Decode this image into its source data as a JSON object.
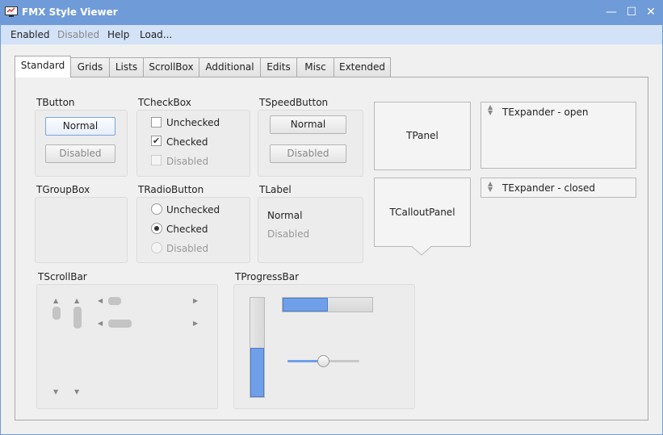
{
  "window": {
    "title": "FMX Style Viewer",
    "minimize_glyph": "—",
    "maximize_glyph": "☐",
    "close_glyph": "✕",
    "accent_color": "#6f9bd8"
  },
  "menu": {
    "items": [
      {
        "label": "Enabled"
      },
      {
        "label": "Disabled"
      },
      {
        "label": "Help"
      },
      {
        "label": "Load..."
      }
    ]
  },
  "tabs": [
    {
      "label": "Standard"
    },
    {
      "label": "Grids"
    },
    {
      "label": "Lists"
    },
    {
      "label": "ScrollBox"
    },
    {
      "label": "Additional"
    },
    {
      "label": "Edits"
    },
    {
      "label": "Misc"
    },
    {
      "label": "Extended"
    }
  ],
  "standard": {
    "tbutton": {
      "label": "TButton",
      "normal": "Normal",
      "disabled": "Disabled"
    },
    "tcheckbox": {
      "label": "TCheckBox",
      "unchecked": "Unchecked",
      "checked": "Checked",
      "disabled": "Disabled"
    },
    "tspeedbutton": {
      "label": "TSpeedButton",
      "normal": "Normal",
      "disabled": "Disabled"
    },
    "tgroupbox": {
      "label": "TGroupBox"
    },
    "tradiobutton": {
      "label": "TRadioButton",
      "unchecked": "Unchecked",
      "checked": "Checked",
      "disabled": "Disabled"
    },
    "tlabel": {
      "label": "TLabel",
      "normal": "Normal",
      "disabled": "Disabled"
    },
    "tpanel": {
      "label": "TPanel"
    },
    "tcalloutpanel": {
      "label": "TCalloutPanel"
    },
    "texpander_open": {
      "label": "TExpander - open"
    },
    "texpander_closed": {
      "label": "TExpander - closed"
    },
    "tscrollbar": {
      "label": "TScrollBar"
    },
    "tprogressbar": {
      "label": "TProgressBar",
      "vertical_progress": 0.5,
      "horizontal_progress": 0.5,
      "trackbar_position": 0.5
    },
    "checkbox_checked_glyph": "✔",
    "arrow_up": "▲",
    "arrow_down": "▼",
    "arrow_left": "◀",
    "arrow_right": "▶",
    "progress_color": "#6e9fe8"
  }
}
